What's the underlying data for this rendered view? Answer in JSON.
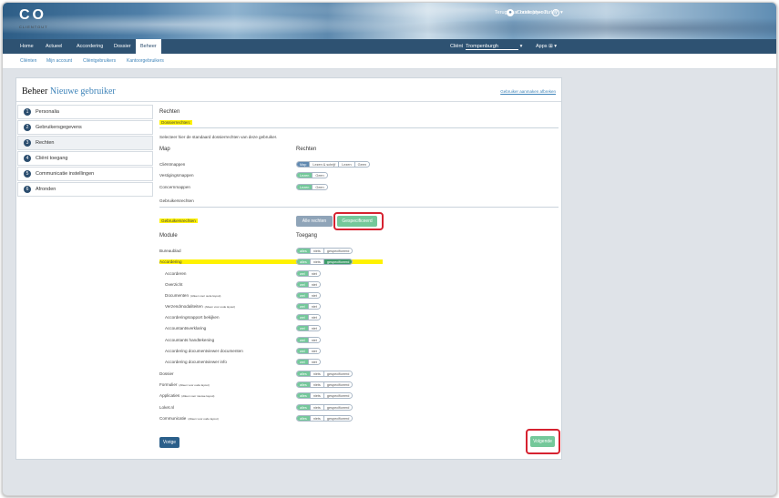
{
  "header": {
    "logo": "CO",
    "logo_sub": "CLIENTOUT",
    "back_link": "Terug naar oude lay-out",
    "help": "?",
    "user": "Christopher Turley"
  },
  "nav": {
    "tabs": [
      "Home",
      "Actueel",
      "Accordering",
      "Dossier",
      "Beheer"
    ],
    "client_label": "Cliënt",
    "client_value": "Trompenburgh",
    "apps": "Apps"
  },
  "subnav": [
    "Cliënten",
    "Mijn account",
    "Cliëntgebruikers",
    "Kantoorgebruikers"
  ],
  "page": {
    "title_prefix": "Beheer",
    "title": "Nieuwe gebruiker",
    "wizard_link": "Gebruiker aanmaken afbreken"
  },
  "steps": [
    {
      "n": "1",
      "label": "Personalia"
    },
    {
      "n": "2",
      "label": "Gebruikersgegevens"
    },
    {
      "n": "3",
      "label": "Rechten"
    },
    {
      "n": "4",
      "label": "Cliënt toegang"
    },
    {
      "n": "5",
      "label": "Communicatie instellingen"
    },
    {
      "n": "6",
      "label": "Afronden"
    }
  ],
  "main": {
    "section": "Rechten",
    "dossier_title": "Dossierrechten:",
    "dossier_desc": "Selecteer hier de standaard dossierrechten van deze gebruiker.",
    "col_map": "Map",
    "col_rechten": "Rechten",
    "maps": [
      {
        "name": "Cliëntmappen",
        "opts": [
          "Map",
          "Lezen & schrijf",
          "Lezen",
          "Geen"
        ]
      },
      {
        "name": "Vestigingsmappen",
        "opts": [
          "Lezen",
          "Geen"
        ]
      },
      {
        "name": "Concernmappen",
        "opts": [
          "Lezen",
          "Geen"
        ]
      }
    ],
    "user_rights_section": "Gebruikersrechten",
    "user_rights_title": "Gebruikersrechten",
    "btn_all": "Alle rechten",
    "btn_spec": "Gespecificeerd",
    "col_module": "Module",
    "col_toegang": "Toegang",
    "modules": [
      {
        "name": "Bureaublad",
        "opts": [
          "alles",
          "niets",
          "gespecificeerd"
        ]
      },
      {
        "name": "Accordering",
        "opts": [
          "alles",
          "niets",
          "gespecificeerd"
        ]
      },
      {
        "name": "Accorderen",
        "opts": [
          "wel",
          "niet"
        ]
      },
      {
        "name": "Overzicht",
        "opts": [
          "wel",
          "niet"
        ]
      },
      {
        "name": "Documenten",
        "note": "(Alleen voor oude layout)",
        "opts": [
          "wel",
          "niet"
        ]
      },
      {
        "name": "Verzendmodaliteiten",
        "note": "(Alleen voor oude layout)",
        "opts": [
          "wel",
          "niet"
        ]
      },
      {
        "name": "Accorderingsrapport bekijken",
        "opts": [
          "wel",
          "niet"
        ]
      },
      {
        "name": "Accountantsverklaring",
        "opts": [
          "wel",
          "niet"
        ]
      },
      {
        "name": "Accountants handtekening",
        "opts": [
          "wel",
          "niet"
        ]
      },
      {
        "name": "Accordering documentviewer documenten",
        "opts": [
          "wel",
          "niet"
        ]
      },
      {
        "name": "Accordering documentviewer info",
        "opts": [
          "wel",
          "niet"
        ]
      },
      {
        "name": "Dossier",
        "opts": [
          "alles",
          "niets",
          "gespecificeerd"
        ]
      },
      {
        "name": "Formulier",
        "note": "(Alleen voor oude layout)",
        "opts": [
          "alles",
          "niets",
          "gespecificeerd"
        ]
      },
      {
        "name": "Applicaties",
        "note": "(Alleen voor nieuwe layout)",
        "opts": [
          "alles",
          "niets",
          "gespecificeerd"
        ]
      },
      {
        "name": "Loket.nl",
        "opts": [
          "alles",
          "niets",
          "gespecificeerd"
        ]
      },
      {
        "name": "Communicatie",
        "note": "(Alleen voor oude layout)",
        "opts": [
          "alles",
          "niets",
          "gespecificeerd"
        ]
      }
    ],
    "btn_prev": "Vorige",
    "btn_next": "Volgende"
  },
  "colors": {
    "accent": "#3f84b9",
    "nav": "#2e5272",
    "green": "#74c89a",
    "highlight": "#fff200",
    "red": "#d62230"
  }
}
